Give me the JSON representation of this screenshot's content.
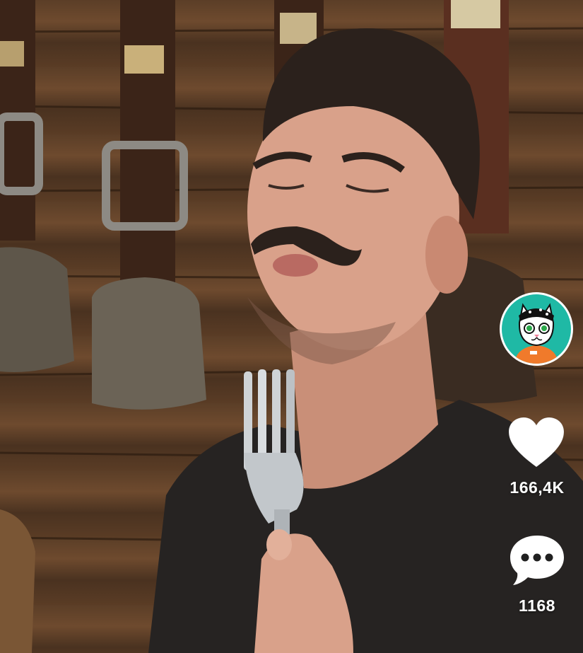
{
  "video": {
    "scene_description_icon": "man-with-fork-video"
  },
  "actions": {
    "avatar_icon": "cat-avatar-icon",
    "like_icon": "heart-icon",
    "like_count": "166,4K",
    "comment_icon": "comment-bubble-icon",
    "comment_count": "1168"
  },
  "colors": {
    "avatar_bg": "#1fb9a5",
    "action_icon": "#ffffff"
  }
}
